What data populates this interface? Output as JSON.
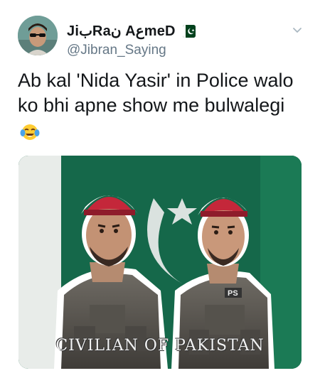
{
  "tweet": {
    "display_name": "JiبRaن AعmeD",
    "handle": "@Jibran_Saying",
    "text": "Ab kal 'Nida Yasir' in Police walo ko bhi apne show me bulwalegi",
    "emoji": "face-with-tears-of-joy",
    "flag": "pakistan-flag-icon"
  },
  "media": {
    "watermark": "CIVILIAN OF PAKISTAN",
    "badge": "PS"
  },
  "colors": {
    "text": "#14171a",
    "secondary": "#657786",
    "flag_green": "#01411c",
    "banner_green": "#15684a"
  }
}
